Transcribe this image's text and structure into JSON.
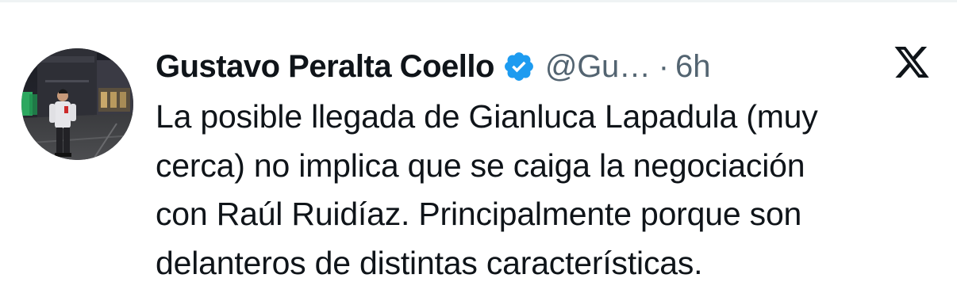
{
  "tweet": {
    "author": {
      "display_name": "Gustavo Peralta Coello",
      "handle": "@Gu…",
      "verified_icon": "verified-badge-icon",
      "avatar": "profile-photo"
    },
    "separator": "·",
    "time": "6h",
    "brand_icon": "x-logo-icon",
    "text_lines": [
      "La posible llegada de Gianluca Lapadula (muy",
      "cerca) no implica que se caiga la negociación",
      "con Raúl Ruidíaz. Principalmente porque son",
      "delanteros de distintas características."
    ],
    "colors": {
      "text": "#0f1419",
      "secondary": "#536471",
      "verified": "#1d9bf0"
    }
  }
}
